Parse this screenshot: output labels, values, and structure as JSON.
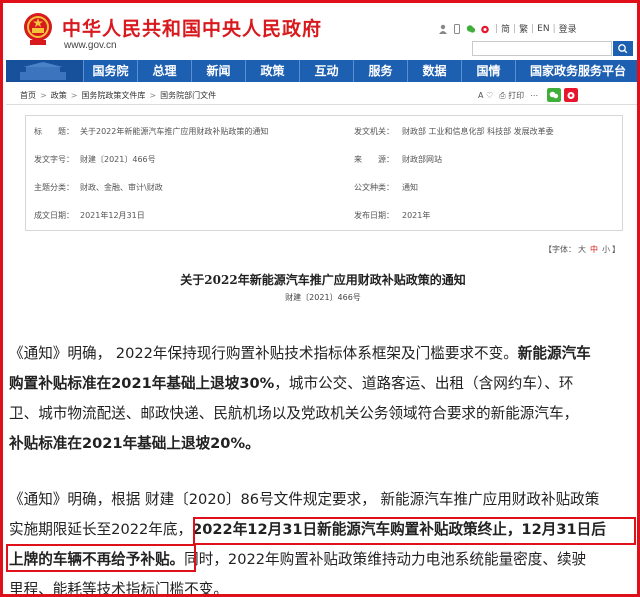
{
  "header": {
    "site_title": "中华人民共和国中央人民政府",
    "site_url": "www.gov.cn",
    "top_links": [
      "简",
      "繁",
      "EN",
      "登录"
    ],
    "search_placeholder": ""
  },
  "nav": {
    "items": [
      "国务院",
      "总理",
      "新闻",
      "政策",
      "互动",
      "服务",
      "数据",
      "国情",
      "国家政务服务平台"
    ]
  },
  "breadcrumb": {
    "items": [
      "首页",
      "政策",
      "国务院政策文件库",
      "国务院部门文件"
    ]
  },
  "tools": {
    "font_label": "A",
    "print_label": "打印"
  },
  "metadata": {
    "title_label": "标　　题：",
    "title_value": "关于2022年新能源汽车推广应用财政补贴政策的通知",
    "issuer_label": "发文机关：",
    "issuer_value": "财政部  工业和信息化部  科技部  发展改革委",
    "doc_no_label": "发文字号：",
    "doc_no_value": "财建〔2021〕466号",
    "source_label": "来　　源：",
    "source_value": "财政部网站",
    "topic_label": "主题分类：",
    "topic_value": "财政、金融、审计\\财政",
    "type_label": "公文种类：",
    "type_value": "通知",
    "date_label": "成文日期：",
    "date_value": "2021年12月31日",
    "year_label": "发布日期：",
    "year_value": "2021年"
  },
  "fontsize": {
    "label": "【字体：",
    "large": "大",
    "medium": "中",
    "small": "小",
    "close": "】"
  },
  "document": {
    "title": "关于2022年新能源汽车推广应用财政补贴政策的通知",
    "number": "财建〔2021〕466号"
  },
  "article": {
    "p1_line1_normal": "《通知》明确， 2022年保持现行购置补贴技术指标体系框架及门槛要求不变。",
    "p1_line1_bold": "新能源汽车",
    "p1_line2_bold": "购置补贴标准在2021年基础上退坡30%",
    "p1_line2_normal": "，城市公交、道路客运、出租（含网约车）、环",
    "p1_line3": "卫、城市物流配送、邮政快递、民航机场以及党政机关公务领域符合要求的新能源汽车，",
    "p1_line4_bold": "补贴标准在2021年基础上退坡20%。",
    "p2_line1": "《通知》明确，根据 财建〔2020〕86号文件规定要求， 新能源汽车推广应用财政补贴政策",
    "p2_line2_normal": "实施期限延长至2022年底，",
    "p2_line2_bold": "2022年12月31日新能源汽车购置补贴政策终止，12月31日后",
    "p2_line3_bold": "上牌的车辆不再给予补贴。",
    "p2_line3_normal": "同时，2022年购置补贴政策维持动力电池系统能量密度、续驶",
    "p2_line4": "里程、能耗等技术指标门槛不变。"
  },
  "colors": {
    "brand_red": "#d81a1e",
    "nav_blue": "#1d5fb0",
    "highlight_border": "#e0101a"
  }
}
